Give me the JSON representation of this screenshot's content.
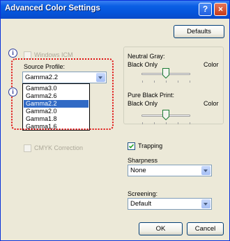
{
  "window": {
    "title": "Advanced Color Settings",
    "help_glyph": "?",
    "close_glyph": "×"
  },
  "buttons": {
    "defaults": "Defaults",
    "ok": "OK",
    "cancel": "Cancel"
  },
  "left": {
    "windows_icm": "Windows ICM",
    "source_profile_label": "Source Profile:",
    "source_profile_value": "Gamma2.2",
    "profile_options": [
      "Gamma3.0",
      "Gamma2.6",
      "Gamma2.2",
      "Gamma2.0",
      "Gamma1.8",
      "Gamma1.6"
    ],
    "selected_index": 2,
    "cmyk_correction": "CMYK Correction"
  },
  "right": {
    "neutral_gray": {
      "label": "Neutral Gray:",
      "min": "Black Only",
      "max": "Color",
      "position_fraction": 0.5
    },
    "pure_black": {
      "label": "Pure Black Print:",
      "min": "Black Only",
      "max": "Color",
      "position_fraction": 0.5
    },
    "trapping": {
      "label": "Trapping",
      "checked": true
    },
    "sharpness": {
      "label": "Sharpness",
      "value": "None"
    },
    "screening": {
      "label": "Screening:",
      "value": "Default"
    }
  },
  "callouts": [
    "i",
    "i"
  ]
}
